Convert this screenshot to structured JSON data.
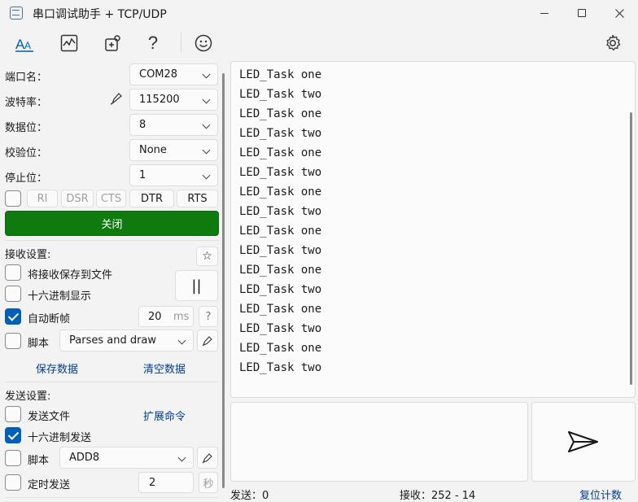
{
  "window": {
    "title": "串口调试助手 + TCP/UDP"
  },
  "toolbar": {
    "icons": [
      "text-style-icon",
      "chart-icon",
      "plugin-icon",
      "help-icon",
      "emoji-icon",
      "settings-icon"
    ]
  },
  "serial": {
    "port_label": "端口名：",
    "port_value": "COM28",
    "baud_label": "波特率：",
    "baud_value": "115200",
    "databits_label": "数据位：",
    "databits_value": "8",
    "parity_label": "校验位：",
    "parity_value": "None",
    "stopbits_label": "停止位：",
    "stopbits_value": "1",
    "signals": {
      "ri": "RI",
      "dsr": "DSR",
      "cts": "CTS",
      "dtr": "DTR",
      "rts": "RTS"
    },
    "open_button": "关闭"
  },
  "receive": {
    "header": "接收设置:",
    "save_to_file": "将接收保存到文件",
    "hex_display": "十六进制显示",
    "auto_frame": "自动断帧",
    "auto_frame_value": "20",
    "auto_frame_unit": "ms",
    "help": "?",
    "script_label": "脚本",
    "script_value": "Parses and draw",
    "save_data": "保存数据",
    "clear_data": "清空数据",
    "pause_icon": "||",
    "star_icon": "☆"
  },
  "send": {
    "header": "发送设置:",
    "send_file": "发送文件",
    "ext_cmd": "扩展命令",
    "hex_send": "十六进制发送",
    "script_label": "脚本",
    "script_value": "ADD8",
    "timed_send": "定时发送",
    "timed_value": "2",
    "timed_unit": "秒"
  },
  "received_lines": [
    "LED_Task one",
    "LED_Task two",
    "LED_Task one",
    "LED_Task two",
    "LED_Task one",
    "LED_Task two",
    "LED_Task one",
    "LED_Task two",
    "LED_Task one",
    "LED_Task two",
    "LED_Task one",
    "LED_Task two",
    "LED_Task one",
    "LED_Task two",
    "LED_Task one",
    "LED_Task two"
  ],
  "status": {
    "sent": "发送：0",
    "received": "接收：252 - 14",
    "reset": "复位计数"
  },
  "colors": {
    "accent": "#005fb8",
    "open_button": "#0f7b0f",
    "link": "#003e92"
  }
}
